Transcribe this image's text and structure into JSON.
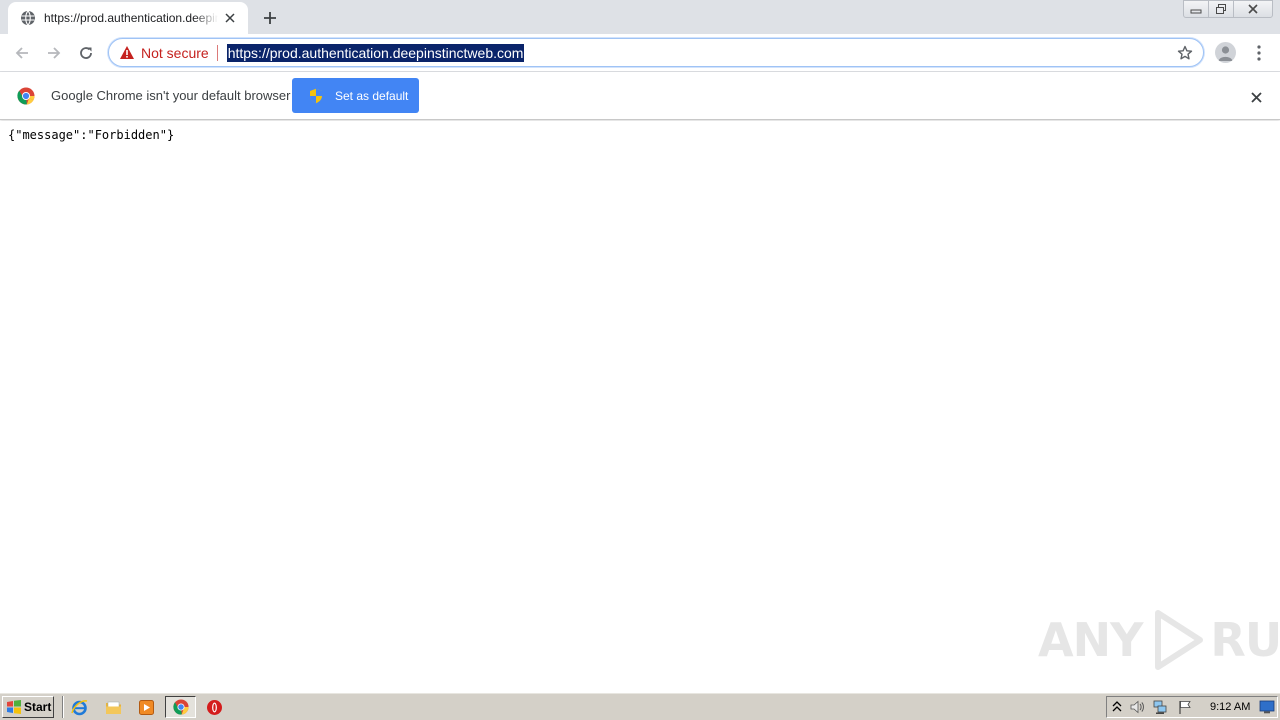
{
  "tab": {
    "title": "https://prod.authentication.deepinstinctweb.com",
    "favicon_icon": "globe-icon",
    "close_icon": "close-icon"
  },
  "toolbar": {
    "back_icon": "arrow-left-icon",
    "forward_icon": "arrow-right-icon",
    "reload_icon": "reload-icon",
    "security_label": "Not secure",
    "url": "https://prod.authentication.deepinstinctweb.com",
    "bookmark_icon": "star-icon",
    "profile_icon": "avatar-icon",
    "menu_icon": "kebab-menu-icon"
  },
  "infobar": {
    "message": "Google Chrome isn't your default browser",
    "button_label": "Set as default",
    "close_icon": "close-icon"
  },
  "page": {
    "body_text": "{\"message\":\"Forbidden\"}"
  },
  "watermark": {
    "left": "ANY",
    "right": "RUN"
  },
  "taskbar": {
    "start_label": "Start",
    "quick_launch": [
      "ie-icon",
      "explorer-folder-icon",
      "media-player-icon",
      "chrome-icon",
      "opera-icon"
    ],
    "tray_icons": [
      "expand-tray-icon",
      "volume-icon",
      "network-icon",
      "action-center-flag-icon"
    ],
    "clock": "9:12 AM"
  },
  "colors": {
    "tabstrip_bg": "#dee1e6",
    "not_secure_red": "#c5221f",
    "url_selection_bg": "#0a246a",
    "button_blue": "#4285f4",
    "taskbar_bg": "#d4d0c8"
  }
}
